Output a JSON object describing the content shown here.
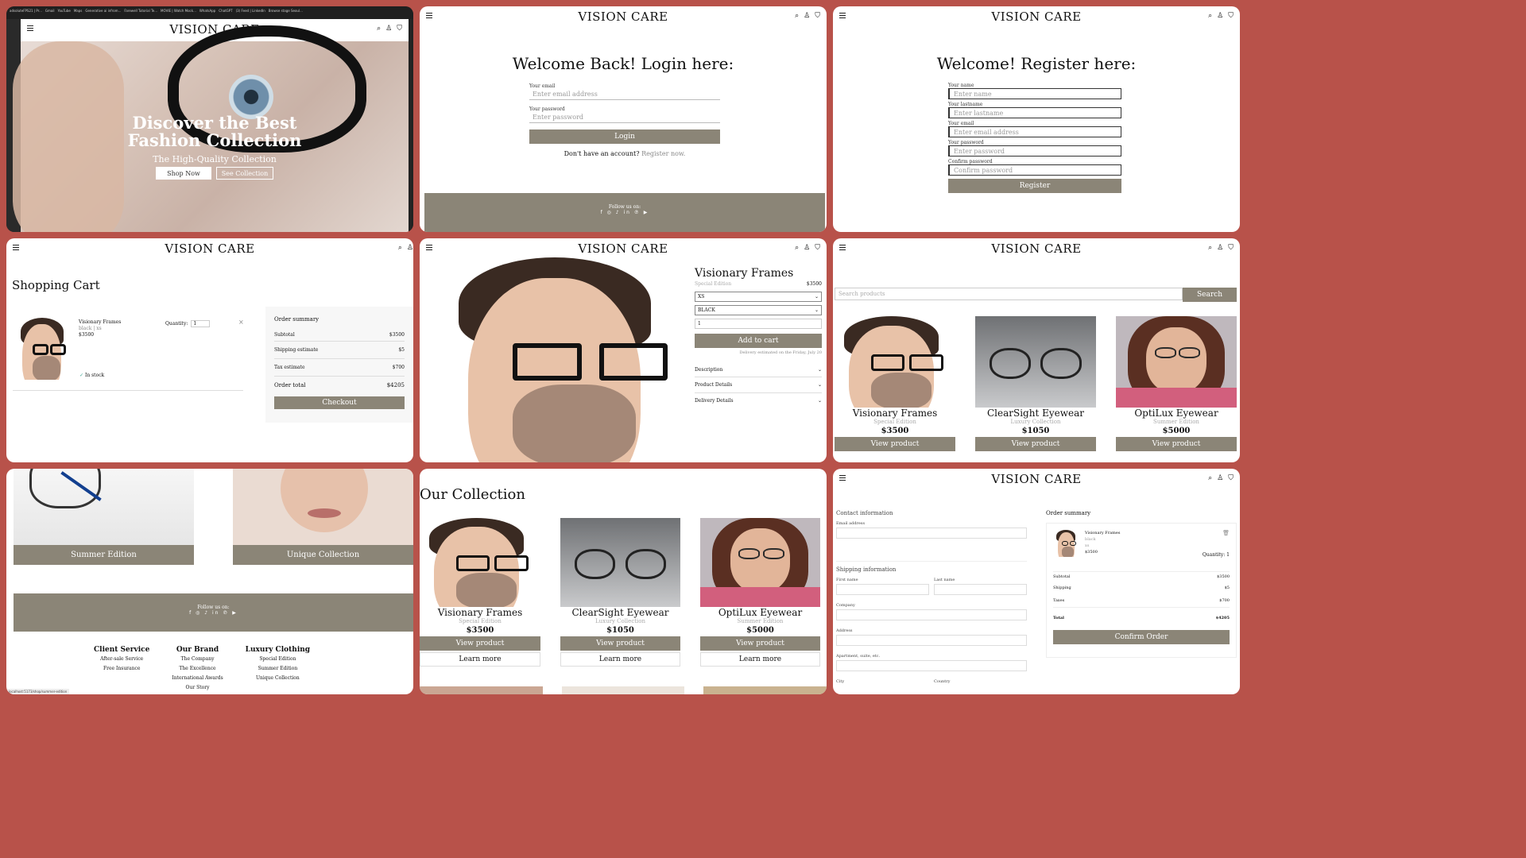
{
  "brand": "VISION CARE",
  "browser": {
    "tabs": [
      "adsoluteFPS21 | Pr...",
      "Gmail",
      "YouTube",
      "Maps",
      "Generative ai infrom...",
      "Farewell Tutorial Te...",
      "MOVIE | Watch Mock...",
      "WhatsApp",
      "ChatGPT",
      "(3) Feed | LinkedIn",
      "Browse stage Seoul..."
    ],
    "status_url": "localhost:5173/shop/summer-edition"
  },
  "hero": {
    "title_line1": "Discover the Best",
    "title_line2": "Fashion Collection",
    "subtitle": "The High-Quality Collection",
    "shop_now": "Shop Now",
    "see_collection": "See Collection"
  },
  "login": {
    "title": "Welcome Back! Login here:",
    "email_label": "Your email",
    "email_placeholder": "Enter email address",
    "password_label": "Your password",
    "password_placeholder": "Enter password",
    "button": "Login",
    "no_account": "Don't have an account?",
    "register_link": "Register now."
  },
  "footer": {
    "follow": "Follow us on:",
    "social": "f ◎ ♪ in ℗ ▶"
  },
  "register": {
    "title": "Welcome! Register here:",
    "name_label": "Your name",
    "name_placeholder": "Enter name",
    "lastname_label": "Your lastname",
    "lastname_placeholder": "Enter lastname",
    "email_label": "Your email",
    "email_placeholder": "Enter email address",
    "password_label": "Your password",
    "password_placeholder": "Enter password",
    "confirm_label": "Confirm password",
    "confirm_placeholder": "Confirm password",
    "button": "Register"
  },
  "cart": {
    "title": "Shopping Cart",
    "item_name": "Visionary Frames",
    "item_color": "black",
    "item_size": "xs",
    "item_price": "$3500",
    "quantity_label": "Quantity:",
    "quantity_value": "1",
    "stock": "In stock",
    "summary_title": "Order summary",
    "subtotal_label": "Subtotal",
    "subtotal_value": "$3500",
    "shipping_label": "Shipping estimate",
    "shipping_value": "$5",
    "tax_label": "Tax estimate",
    "tax_value": "$700",
    "total_label": "Order total",
    "total_value": "$4205",
    "checkout": "Checkout"
  },
  "product": {
    "name": "Visionary Frames",
    "collection": "Special Edition",
    "price": "$3500",
    "size": "XS",
    "color": "BLACK",
    "qty": "1",
    "add_to_cart": "Add to cart",
    "delivery": "Delivery estimated on the Friday, July 20",
    "sections": [
      "Description",
      "Product Details",
      "Delivery Details"
    ]
  },
  "shop": {
    "search_placeholder": "Search products",
    "search_button": "Search",
    "view_product": "View product",
    "learn_more": "Learn more"
  },
  "products": [
    {
      "name": "Visionary Frames",
      "collection": "Special Edition",
      "price": "$3500"
    },
    {
      "name": "ClearSight Eyewear",
      "collection": "Luxury Collection",
      "price": "$1050"
    },
    {
      "name": "OptiLux Eyewear",
      "collection": "Summer Edition",
      "price": "$5000"
    }
  ],
  "home2": {
    "banner1": "Summer Edition",
    "banner2": "Unique Collection",
    "columns": [
      {
        "title": "Client Service",
        "links": [
          "After-sale Service",
          "Free Insurance"
        ]
      },
      {
        "title": "Our Brand",
        "links": [
          "The Company",
          "The Excellence",
          "International Awards",
          "Our Story"
        ]
      },
      {
        "title": "Luxury Clothing",
        "links": [
          "Special Edition",
          "Summer Edition",
          "Unique Collection"
        ]
      }
    ]
  },
  "collection": {
    "title": "Our Collection"
  },
  "checkout": {
    "contact_title": "Contact information",
    "email_label": "Email address",
    "shipping_title": "Shipping information",
    "first_name": "First name",
    "last_name": "Last name",
    "company": "Company",
    "address": "Address",
    "apartment": "Apartment, suite, etc.",
    "city": "City",
    "country": "Country",
    "summary_title": "Order summary",
    "item_name": "Visionary Frames",
    "item_color": "black",
    "item_size": "xs",
    "item_price": "$3500",
    "qty_label": "Quantity: 1",
    "subtotal_label": "Subtotal",
    "subtotal_value": "$3500",
    "shipping_label": "Shipping",
    "shipping_value": "$5",
    "taxes_label": "Taxes",
    "taxes_value": "$700",
    "total_label": "Total",
    "total_value": "$4205",
    "confirm": "Confirm Order"
  }
}
